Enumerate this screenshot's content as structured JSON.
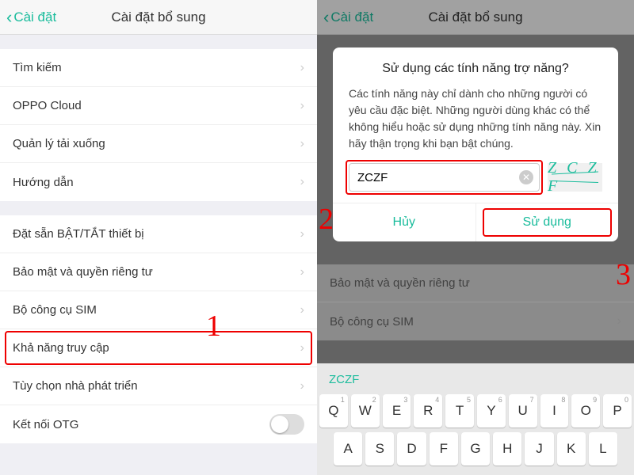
{
  "left": {
    "back": "Cài đặt",
    "title": "Cài đặt bổ sung",
    "group1": [
      "Tìm kiếm",
      "OPPO Cloud",
      "Quản lý tải xuống",
      "Hướng dẫn"
    ],
    "group2": [
      "Đặt sẵn BẬT/TẮT thiết bị",
      "Bảo mật và quyền riêng tư",
      "Bộ công cụ SIM",
      "Khả năng truy cập",
      "Tùy chọn nhà phát triển",
      "Kết nối OTG"
    ]
  },
  "right": {
    "back": "Cài đặt",
    "title": "Cài đặt bổ sung",
    "dialog": {
      "title": "Sử dụng các tính năng trợ năng?",
      "text": "Các tính năng này chỉ dành cho những người có yêu cầu đặc biệt. Những người dùng khác có thể không hiểu hoặc sử dụng những tính năng này. Xin hãy thận trọng khi bạn bật chúng.",
      "input_value": "ZCZF",
      "captcha": "Z C Z F",
      "cancel": "Hủy",
      "confirm": "Sử dụng"
    },
    "bg_rows": [
      "Bảo mật và quyền riêng tư",
      "Bộ công cụ SIM"
    ],
    "suggest": "ZCZF",
    "kb_row1": [
      [
        "Q",
        "1"
      ],
      [
        "W",
        "2"
      ],
      [
        "E",
        "3"
      ],
      [
        "R",
        "4"
      ],
      [
        "T",
        "5"
      ],
      [
        "Y",
        "6"
      ],
      [
        "U",
        "7"
      ],
      [
        "I",
        "8"
      ],
      [
        "O",
        "9"
      ],
      [
        "P",
        "0"
      ]
    ],
    "kb_row2": [
      "A",
      "S",
      "D",
      "F",
      "G",
      "H",
      "J",
      "K",
      "L"
    ]
  },
  "annotations": {
    "n1": "1",
    "n2": "2",
    "n3": "3"
  }
}
